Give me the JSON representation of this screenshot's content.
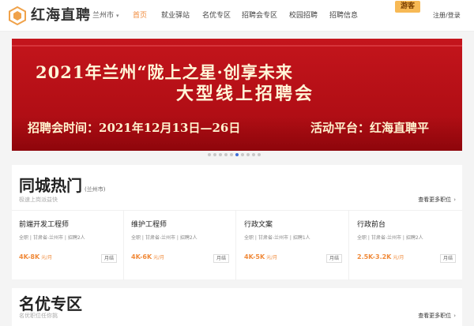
{
  "header": {
    "brand": "红海直聘",
    "city": "兰州市",
    "nav": [
      "首页",
      "就业驿站",
      "名优专区",
      "招聘会专区",
      "校园招聘",
      "招聘信息"
    ],
    "active_nav": "首页",
    "guest_badge": "游客",
    "login": "注册/登录",
    "colors": {
      "accent": "#f08a3a",
      "guest_bg": "#f7b955"
    }
  },
  "banner": {
    "line1": "2021年兰州“陇上之星·创享未来",
    "line2": "大型线上招聘会",
    "time": "招聘会时间：2021年12月13日—26日",
    "platform": "活动平台：红海直聘平",
    "color": "#c4151c"
  },
  "carousel": {
    "count": 10,
    "active_index": 5
  },
  "hot": {
    "title": "同城热门",
    "city": "(兰州市)",
    "subtitle": "极速上岗派益快",
    "more": "查看更多职位",
    "jobs": [
      {
        "title": "前端开发工程师",
        "meta": "全职 | 甘肃省-兰州市 | 招聘2人",
        "salary": "4K-8K",
        "unit": "元/月",
        "tag": "月结"
      },
      {
        "title": "维护工程师",
        "meta": "全职 | 甘肃省-兰州市 | 招聘2人",
        "salary": "4K-6K",
        "unit": "元/月",
        "tag": "月结"
      },
      {
        "title": "行政文案",
        "meta": "全职 | 甘肃省-兰州市 | 招聘1人",
        "salary": "4K-5K",
        "unit": "元/月",
        "tag": "月结"
      },
      {
        "title": "行政前台",
        "meta": "全职 | 甘肃省-兰州市 | 招聘2人",
        "salary": "2.5K-3.2K",
        "unit": "元/月",
        "tag": "月结"
      }
    ]
  },
  "famous": {
    "title": "名优专区",
    "subtitle": "名优职位任你挑",
    "more": "查看更多职位"
  }
}
